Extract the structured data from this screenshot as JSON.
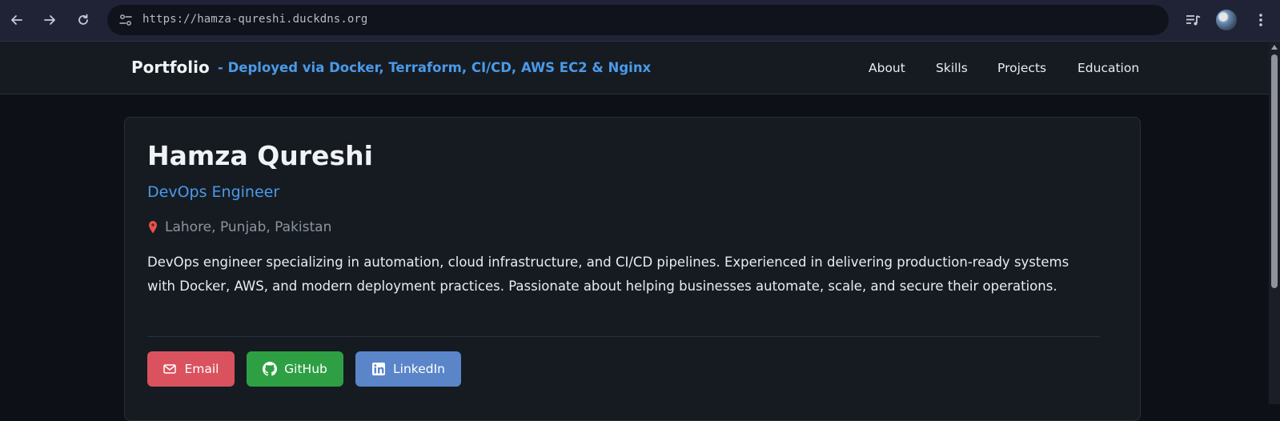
{
  "browser": {
    "url": "https://hamza-qureshi.duckdns.org"
  },
  "header": {
    "brand": "Portfolio",
    "tagline": "- Deployed via Docker, Terraform, CI/CD, AWS EC2 & Nginx",
    "nav": [
      "About",
      "Skills",
      "Projects",
      "Education"
    ]
  },
  "profile": {
    "name": "Hamza Qureshi",
    "role": "DevOps Engineer",
    "location": "Lahore, Punjab, Pakistan",
    "summary": "DevOps engineer specializing in automation, cloud infrastructure, and CI/CD pipelines. Experienced in delivering production-ready systems with Docker, AWS, and modern deployment practices. Passionate about helping businesses automate, scale, and secure their operations.",
    "buttons": {
      "email": "Email",
      "github": "GitHub",
      "linkedin": "LinkedIn"
    }
  },
  "colors": {
    "accent": "#4a9ae8",
    "email_button": "#d9525e",
    "github_button": "#2ea043",
    "linkedin_button": "#5a85c9"
  }
}
